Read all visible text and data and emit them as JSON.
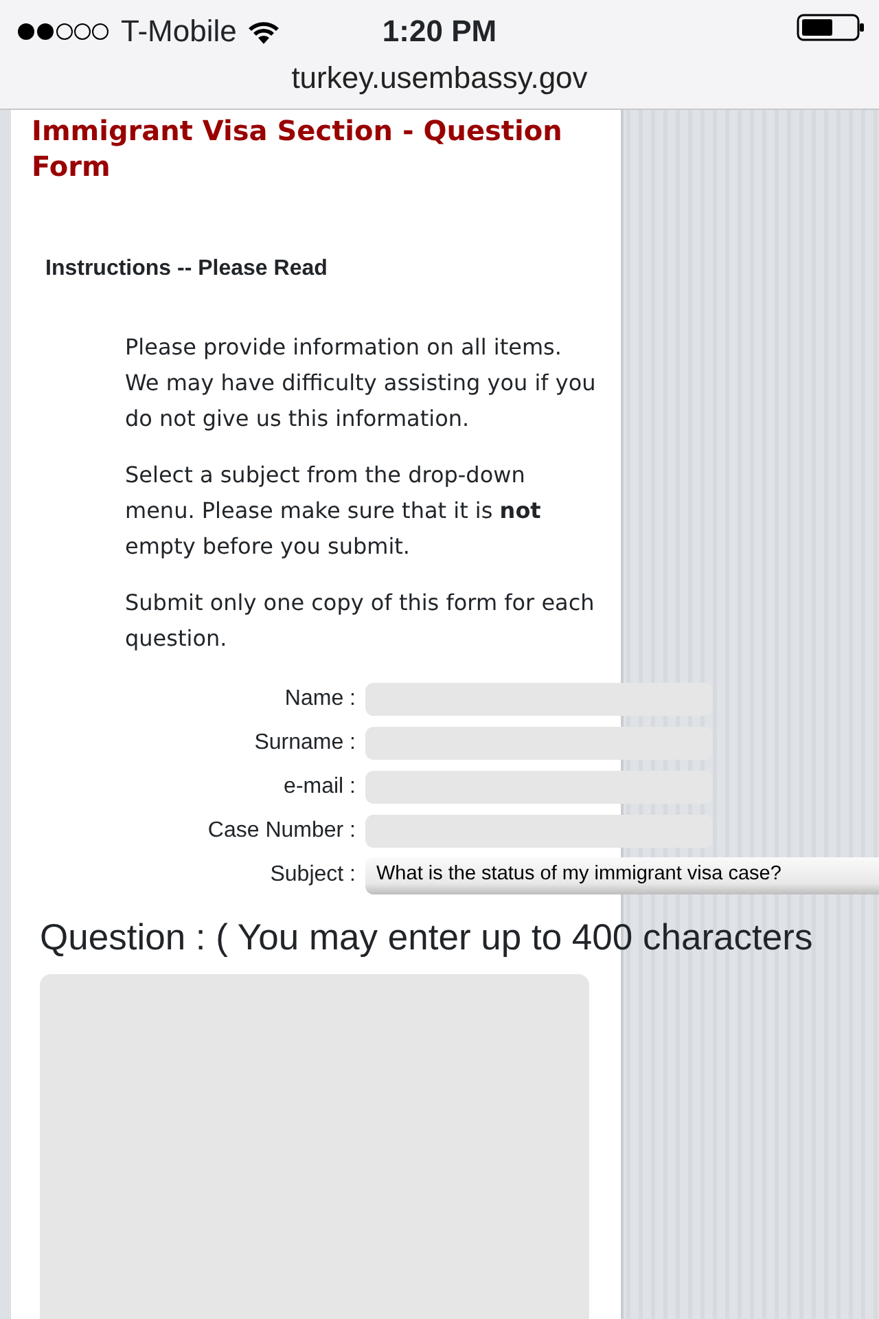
{
  "status_bar": {
    "carrier": "T-Mobile",
    "time": "1:20 PM"
  },
  "address_bar": {
    "url": "turkey.usembassy.gov"
  },
  "page": {
    "title": "Immigrant Visa Section - Question Form",
    "instructions_heading": "Instructions -- Please Read",
    "paragraphs": [
      "Please provide information on all items. We may have difficulty assisting you if you do not give us this information.",
      "Select a subject from the drop-down menu. Please make sure that it is **not** empty before you submit.",
      "Submit only one copy of this form for each question."
    ],
    "fields": [
      {
        "label": "Name :",
        "kind": "text"
      },
      {
        "label": "Surname :",
        "kind": "text"
      },
      {
        "label": "e-mail :",
        "kind": "text"
      },
      {
        "label": "Case Number :",
        "kind": "text"
      },
      {
        "label": "Subject :",
        "kind": "select",
        "value": "What is the status of my immigrant visa case?"
      }
    ],
    "question_label": "Question : ( You may enter up to 400 characters"
  }
}
